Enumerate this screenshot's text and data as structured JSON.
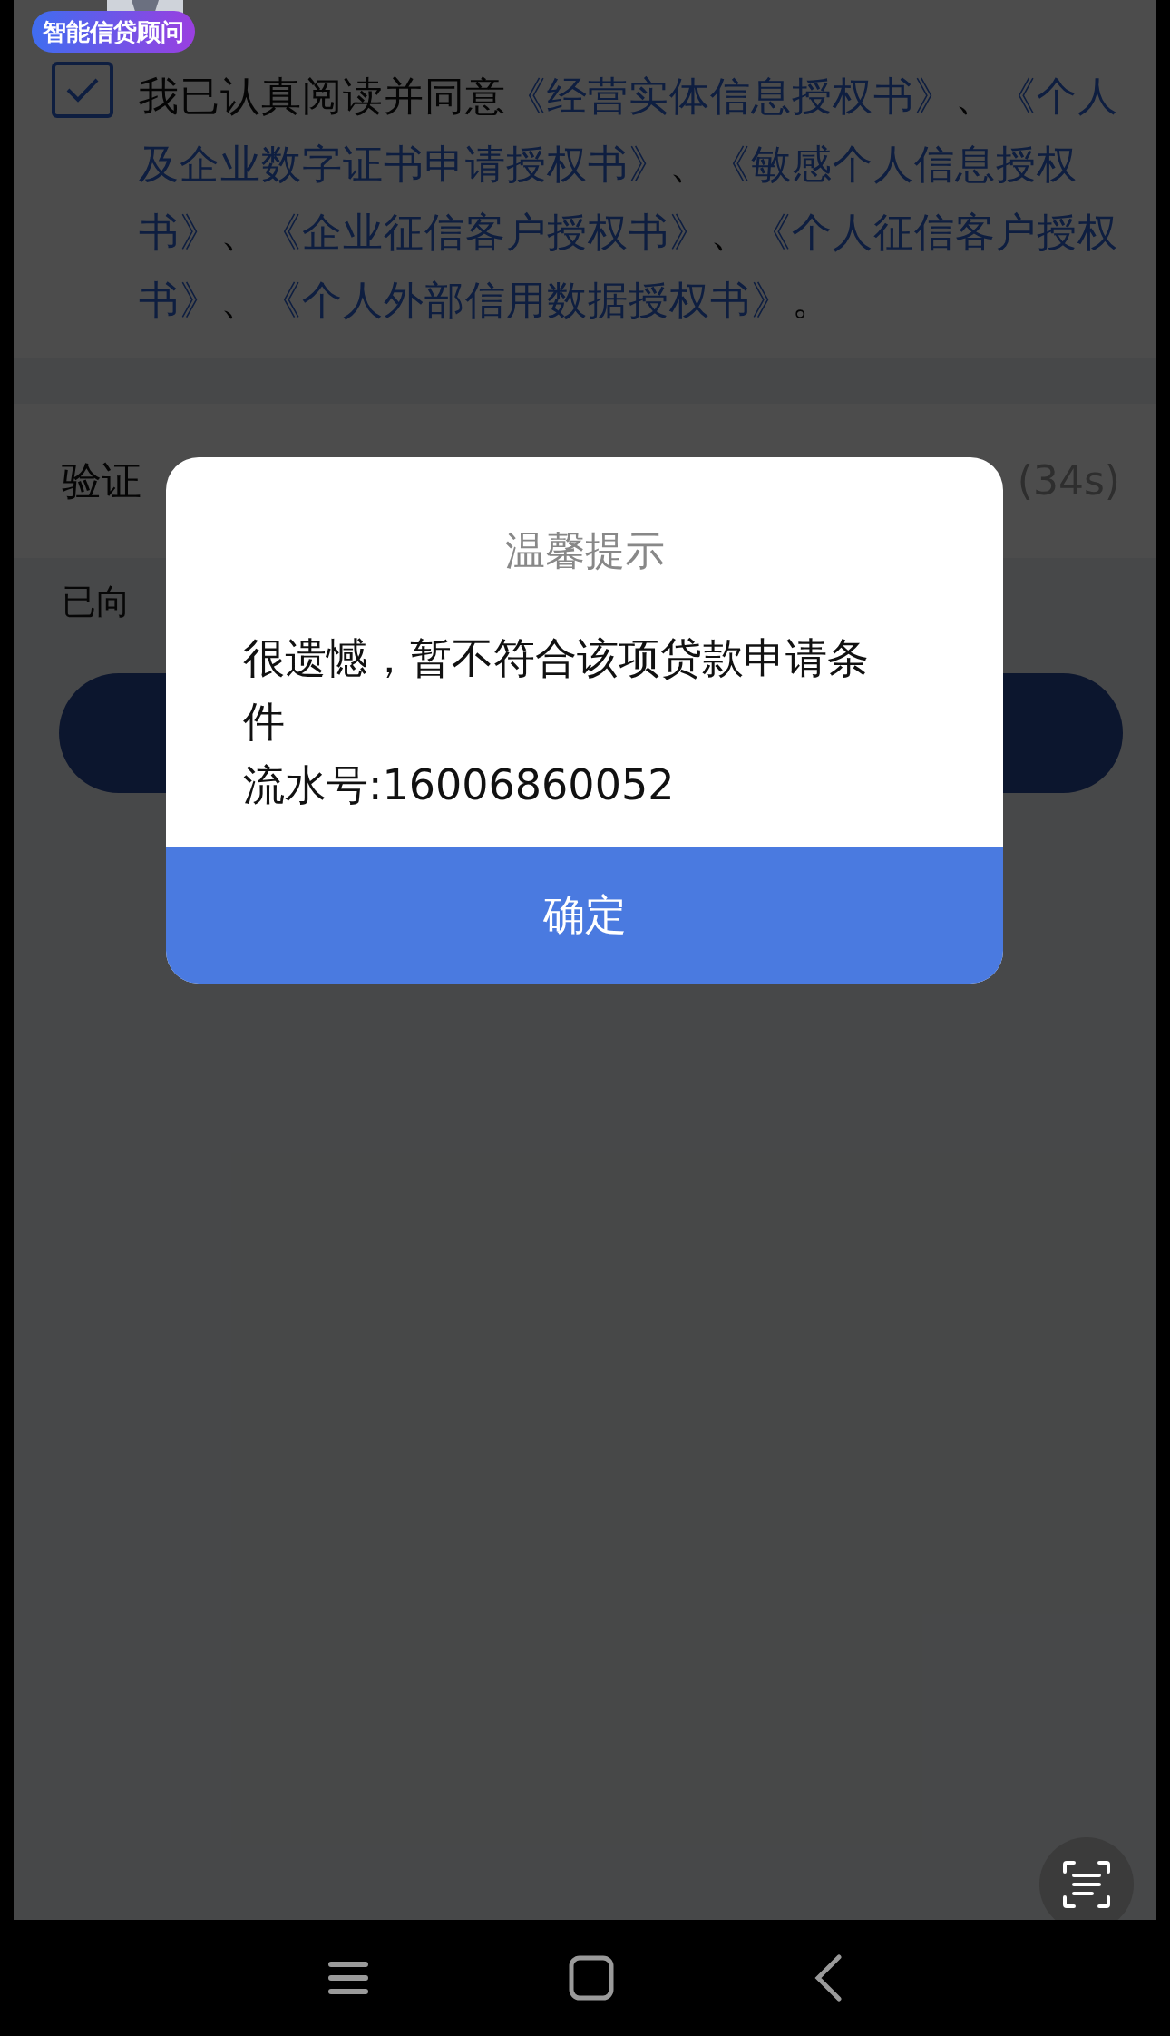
{
  "assistant_badge": {
    "label": "智能信贷顾问"
  },
  "agreement": {
    "checked": true,
    "parts": [
      {
        "kind": "text",
        "text": "我已认真阅读并同意"
      },
      {
        "kind": "link",
        "text": "《经营实体信息授权书》"
      },
      {
        "kind": "text",
        "text": "、"
      },
      {
        "kind": "link",
        "text": "《个人及企业数字证书申请授权书》"
      },
      {
        "kind": "text",
        "text": "、"
      },
      {
        "kind": "link",
        "text": "《敏感个人信息授权书》"
      },
      {
        "kind": "text",
        "text": "、"
      },
      {
        "kind": "link",
        "text": "《企业征信客户授权书》"
      },
      {
        "kind": "text",
        "text": "、"
      },
      {
        "kind": "link",
        "text": "《个人征信客户授权书》"
      },
      {
        "kind": "text",
        "text": "、"
      },
      {
        "kind": "link",
        "text": "《个人外部信用数据授权书》"
      },
      {
        "kind": "text",
        "text": "。"
      }
    ]
  },
  "verification": {
    "label": "验证",
    "countdown": "(34s)",
    "hint": "已向"
  },
  "dialog": {
    "title": "温馨提示",
    "message": "很遗憾，暂不符合该项贷款申请条件",
    "serial": "流水号:16006860052",
    "button": "确定"
  }
}
